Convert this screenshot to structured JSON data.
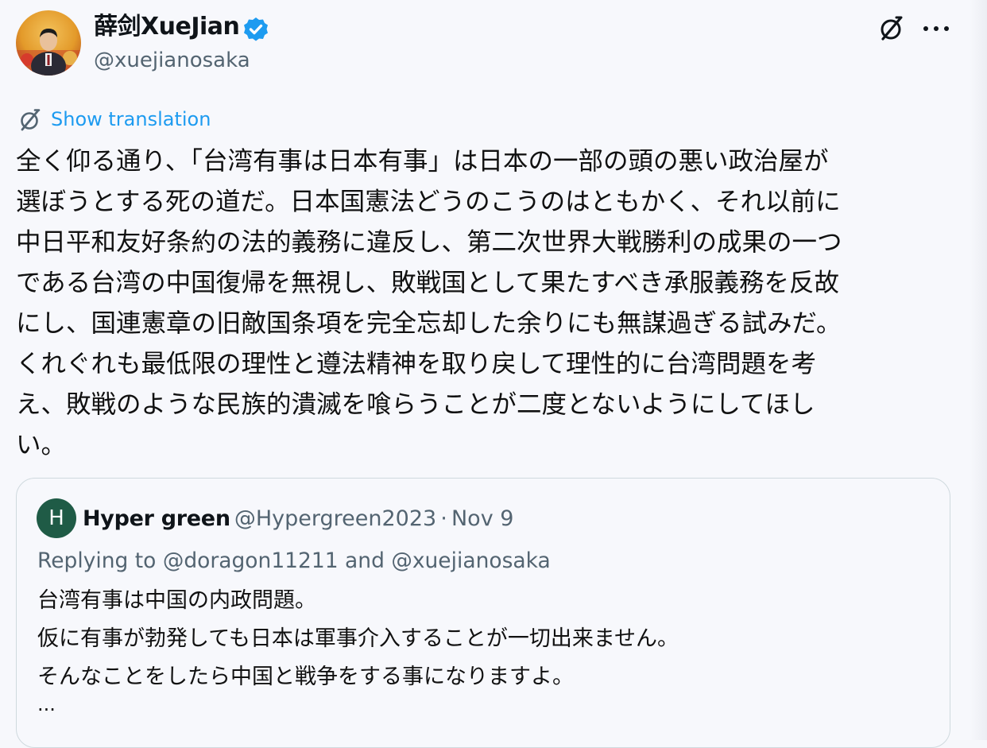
{
  "tweet": {
    "author": {
      "name": "薛剑XueJian",
      "handle": "@xuejianosaka",
      "verified": true,
      "avatar_icon": "profile-photo"
    },
    "actions": {
      "grok_icon": "grok-icon",
      "more_icon": "more-icon"
    },
    "show_translation": "Show translation",
    "body_lines": [
      "全く仰る通り、「台湾有事は日本有事」は日本の一部の頭の悪い政治屋が",
      "選ぼうとする死の道だ。日本国憲法どうのこうのはともかく、それ以前に",
      "中日平和友好条約の法的義務に違反し、第二次世界大戦勝利の成果の一つ",
      "である台湾の中国復帰を無視し、敗戦国として果たすべき承服義務を反故",
      "にし、国連憲章の旧敵国条項を完全忘却した余りにも無謀過ぎる試みだ。",
      "くれぐれも最低限の理性と遵法精神を取り戻して理性的に台湾問題を考",
      "え、敗戦のような民族的潰滅を喰らうことが二度とないようにしてほし",
      "い。"
    ]
  },
  "quoted_tweet": {
    "avatar_letter": "H",
    "name": "Hyper green",
    "handle": "@Hypergreen2023",
    "separator": "·",
    "date": "Nov 9",
    "replying_to": "Replying to @doragon11211 and @xuejianosaka",
    "lines": [
      "台湾有事は中国の内政問題。",
      "仮に有事が勃発しても日本は軍事介入することが一切出来ません。",
      "そんなことをしたら中国と戦争をする事になりますよ。"
    ],
    "ellipsis": "..."
  },
  "colors": {
    "background": "#f7f8fc",
    "link_blue": "#1d9bf0",
    "secondary_text": "#536471",
    "verified_badge": "#1d9bf0",
    "quote_avatar": "#1f5b46",
    "border": "#cfd9de"
  }
}
